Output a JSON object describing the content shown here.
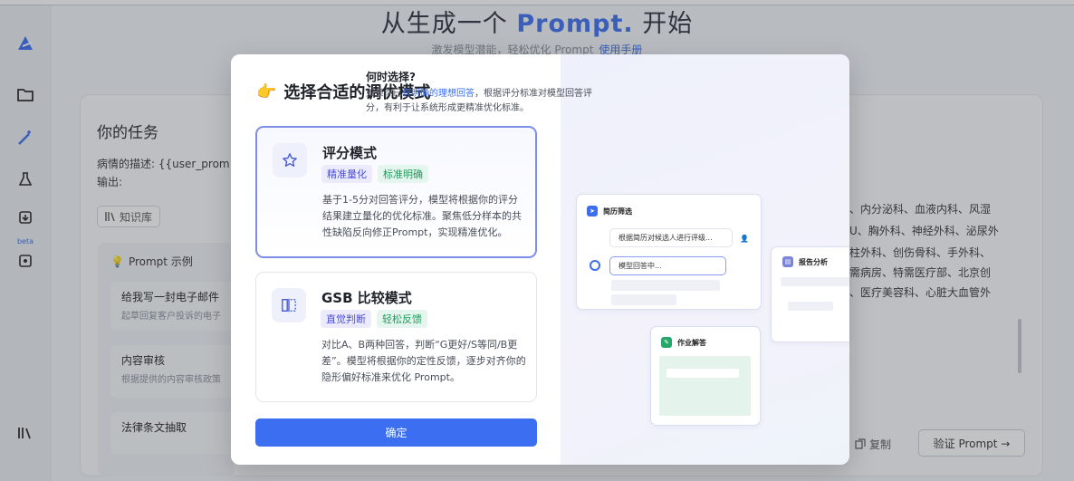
{
  "hero": {
    "title_prefix": "从生成一个",
    "title_accent": "Prompt.",
    "title_suffix": "开始",
    "subtitle": "激发模型潜能，轻松优化 Prompt",
    "manual_link": "使用手册"
  },
  "sidebar": {
    "beta_label": "beta"
  },
  "task": {
    "title": "你的任务",
    "line1": "病情的描述: {{user_prom",
    "line2": "输出:",
    "kb_button": "知识库"
  },
  "examples": {
    "header": "Prompt 示例",
    "items": [
      {
        "title": "给我写一封电子邮件",
        "desc": "起草回复客户投诉的电子"
      },
      {
        "title": "内容审核",
        "desc": "根据提供的内容审核政策"
      },
      {
        "title": "法律条文抽取",
        "desc": ""
      }
    ]
  },
  "right_content": {
    "lines": [
      "、内分泌科、血液内科、风湿",
      "U、胸外科、神经外科、泌尿外",
      "柱外科、创伤骨科、手外科、",
      "需病房、特需医疗部、北京创",
      "、医疗美容科、心脏大血管外"
    ],
    "copy_button": "复制",
    "verify_button": "验证 Prompt →"
  },
  "modal": {
    "title": "选择合适的调优模式",
    "modes": [
      {
        "name": "评分模式",
        "tags": [
          "精准量化",
          "标准明确"
        ],
        "desc": "基于1-5分对回答评分，模型将根据你的评分结果建立量化的优化标准。聚焦低分样本的共性缺陷反向修正Prompt，实现精准优化。"
      },
      {
        "name": "GSB 比较模式",
        "tags": [
          "直觉判断",
          "轻松反馈"
        ],
        "desc": "对比A、B两种回答，判断“G更好/S等同/B更差”。模型将根据你的定性反馈，逐步对齐你的隐形偏好标准来优化 Prompt。"
      }
    ],
    "confirm": "确定"
  },
  "guide": {
    "title": "何时选择?",
    "desc_prefix": "如果你已",
    "desc_highlight": "有明确的理想回答",
    "desc_suffix": "，根据评分标准对模型回答评分，有利于让系统形成更精准优化标准。",
    "card_resume": "简历筛选",
    "card_resume_input": "根据简历对候选人进行评级...",
    "card_resume_reply": "模型回答中...",
    "card_report": "报告分析",
    "card_homework": "作业解答"
  },
  "colors": {
    "accent": "#3b6ef0",
    "selected_border": "#7d8de8",
    "tag_purple": "#4c4fd6",
    "tag_green": "#1f9a5c"
  }
}
